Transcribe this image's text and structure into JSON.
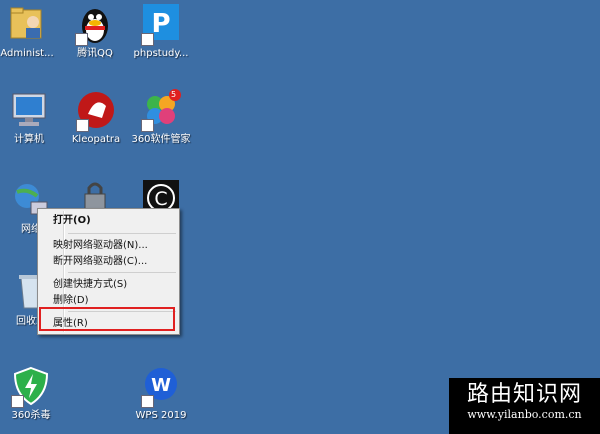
{
  "desktop": {
    "icons": [
      {
        "label": "Administ...",
        "icon": "user-folder-icon"
      },
      {
        "label": "腾讯QQ",
        "icon": "qq-penguin-icon"
      },
      {
        "label": "phpstudy...",
        "icon": "phpstudy-icon"
      },
      {
        "label": "计算机",
        "icon": "computer-icon"
      },
      {
        "label": "Kleopatra",
        "icon": "kleopatra-icon"
      },
      {
        "label": "360软件管家",
        "icon": "360-software-manager-icon",
        "badge": "5"
      },
      {
        "label": "网络",
        "icon": "network-icon"
      },
      {
        "label": "",
        "icon": "locked-shortcut-icon"
      },
      {
        "label": "",
        "icon": "c-app-icon"
      },
      {
        "label": "回收站",
        "icon": "recycle-bin-icon"
      },
      {
        "label": "360杀毒",
        "icon": "360-antivirus-icon"
      },
      {
        "label": "WPS 2019",
        "icon": "wps-icon"
      }
    ],
    "colors": {
      "background": "#3d6ea5",
      "highlight": "#e02020"
    }
  },
  "context_menu": {
    "items": [
      {
        "label": "打开(O)",
        "bold": true
      },
      {
        "label": "映射网络驱动器(N)..."
      },
      {
        "label": "断开网络驱动器(C)..."
      },
      {
        "label": "创建快捷方式(S)"
      },
      {
        "label": "删除(D)"
      },
      {
        "label": "属性(R)",
        "highlighted": true
      }
    ]
  },
  "watermark": {
    "main": "路由知识网",
    "sub": "www.yilanbo.com.cn"
  }
}
